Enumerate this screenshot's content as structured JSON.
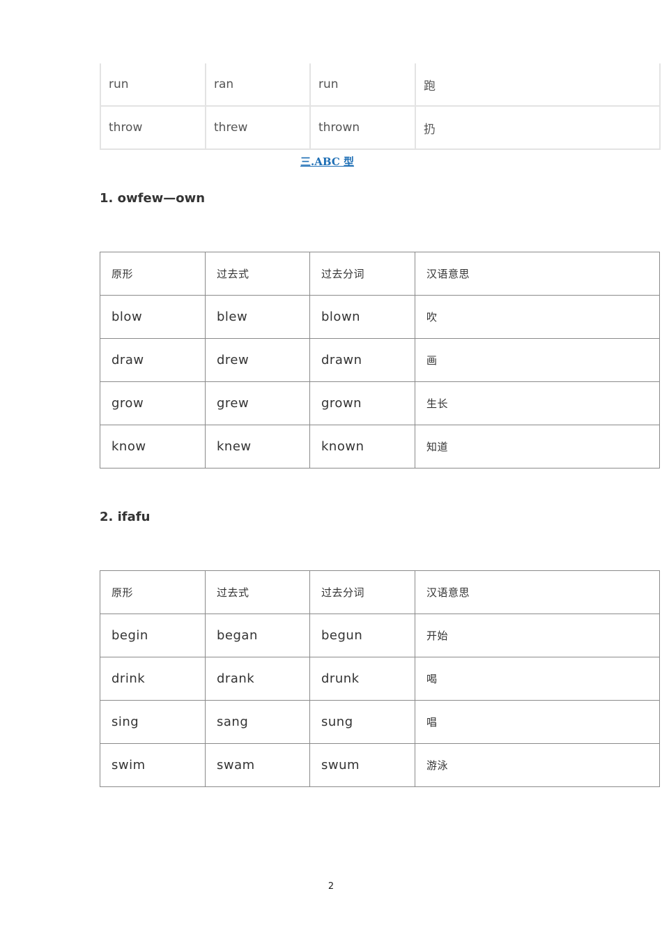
{
  "top_table": {
    "rows": [
      [
        "run",
        "ran",
        "run",
        "跑"
      ],
      [
        "throw",
        "threw",
        "thrown",
        "扔"
      ]
    ]
  },
  "section_title": "三.ABC 型",
  "subsection1": {
    "title": "1. owfew—own",
    "header": [
      "原形",
      "过去式",
      "过去分词",
      "汉语意思"
    ],
    "rows": [
      [
        "blow",
        "blew",
        "blown",
        "吹"
      ],
      [
        "draw",
        "drew",
        "drawn",
        "画"
      ],
      [
        "grow",
        "grew",
        "grown",
        "生长"
      ],
      [
        "know",
        "knew",
        "known",
        "知道"
      ]
    ]
  },
  "subsection2": {
    "title": "2. ifafu",
    "header": [
      "原形",
      "过去式",
      "过去分词",
      "汉语意思"
    ],
    "rows": [
      [
        "begin",
        "began",
        "begun",
        "开始"
      ],
      [
        "drink",
        "drank",
        "drunk",
        "喝"
      ],
      [
        "sing",
        "sang",
        "sung",
        "唱"
      ],
      [
        "swim",
        "swam",
        "swum",
        "游泳"
      ]
    ]
  },
  "page_number": "2"
}
